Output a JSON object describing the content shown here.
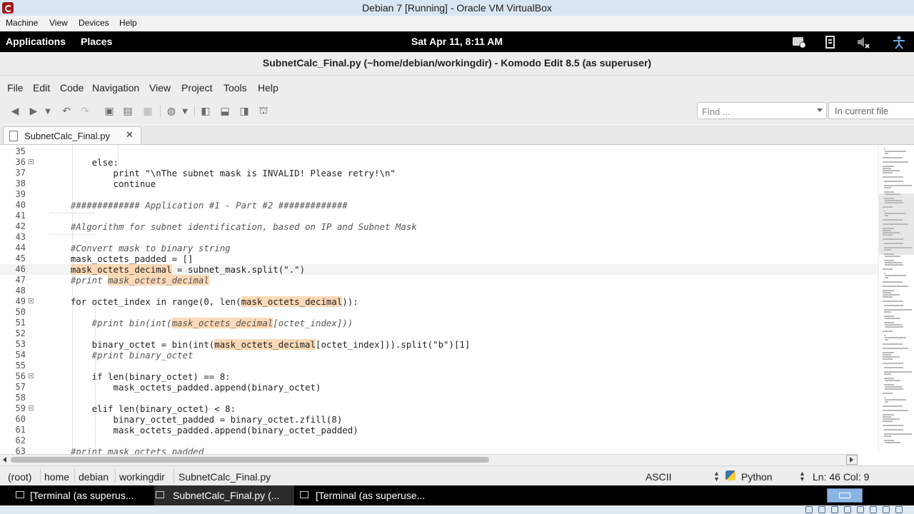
{
  "vm_window": {
    "title": "Debian 7 [Running] - Oracle VM VirtualBox",
    "menu": [
      "Machine",
      "View",
      "Devices",
      "Help"
    ]
  },
  "gnome_panel": {
    "applications": "Applications",
    "places": "Places",
    "clock": "Sat Apr 11,  8:11 AM",
    "tray_icons": [
      "notification-icon",
      "network-icon",
      "volume-muted-icon",
      "accessibility-icon"
    ]
  },
  "komodo": {
    "window_title": "SubnetCalc_Final.py (~home/debian/workingdir) - Komodo Edit 8.5 (as superuser)",
    "menu": [
      "File",
      "Edit",
      "Code",
      "Navigation",
      "View",
      "Project",
      "Tools",
      "Help"
    ],
    "find": {
      "placeholder": "Find ...",
      "scope": "In current file"
    },
    "tab": {
      "label": "SubnetCalc_Final.py",
      "close": "✕"
    }
  },
  "editor": {
    "lines": [
      {
        "n": "35",
        "text": ""
      },
      {
        "n": "36",
        "text": "        else:"
      },
      {
        "n": "37",
        "text": "            print \"\\nThe subnet mask is INVALID! Please retry!\\n\""
      },
      {
        "n": "38",
        "text": "            continue"
      },
      {
        "n": "39",
        "text": ""
      },
      {
        "n": "40",
        "text": "    ############# Application #1 - Part #2 #############"
      },
      {
        "n": "41",
        "text": ""
      },
      {
        "n": "42",
        "text": "    #Algorithm for subnet identification, based on IP and Subnet Mask"
      },
      {
        "n": "43",
        "text": ""
      },
      {
        "n": "44",
        "text": "    #Convert mask to binary string"
      },
      {
        "n": "45",
        "text": "    mask_octets_padded = []"
      },
      {
        "n": "46",
        "text": "    mask_octets_decimal = subnet_mask.split(\".\")"
      },
      {
        "n": "47",
        "text": "    #print mask_octets_decimal"
      },
      {
        "n": "48",
        "text": ""
      },
      {
        "n": "49",
        "text": "    for octet_index in range(0, len(mask_octets_decimal)):"
      },
      {
        "n": "50",
        "text": ""
      },
      {
        "n": "51",
        "text": "        #print bin(int(mask_octets_decimal[octet_index]))"
      },
      {
        "n": "52",
        "text": ""
      },
      {
        "n": "53",
        "text": "        binary_octet = bin(int(mask_octets_decimal[octet_index])).split(\"b\")[1]"
      },
      {
        "n": "54",
        "text": "        #print binary_octet"
      },
      {
        "n": "55",
        "text": ""
      },
      {
        "n": "56",
        "text": "        if len(binary_octet) == 8:"
      },
      {
        "n": "57",
        "text": "            mask_octets_padded.append(binary_octet)"
      },
      {
        "n": "58",
        "text": ""
      },
      {
        "n": "59",
        "text": "        elif len(binary_octet) < 8:"
      },
      {
        "n": "60",
        "text": "            binary_octet_padded = binary_octet.zfill(8)"
      },
      {
        "n": "61",
        "text": "            mask_octets_padded.append(binary_octet_padded)"
      },
      {
        "n": "62",
        "text": ""
      },
      {
        "n": "63",
        "text": "    #print mask_octets_padded"
      }
    ],
    "highlight_word": "mask_octets_decimal",
    "current_line": "46"
  },
  "statusbar": {
    "breadcrumbs": [
      "(root)",
      "home",
      "debian",
      "workingdir",
      "SubnetCalc_Final.py"
    ],
    "encoding": "ASCII",
    "language": "Python",
    "position": "Ln: 46 Col: 9"
  },
  "taskbar": {
    "tasks": [
      {
        "label": "[Terminal (as superus...",
        "active": false
      },
      {
        "label": "SubnetCalc_Final.py (...",
        "active": true
      },
      {
        "label": "[Terminal (as superuse...",
        "active": false
      }
    ]
  }
}
